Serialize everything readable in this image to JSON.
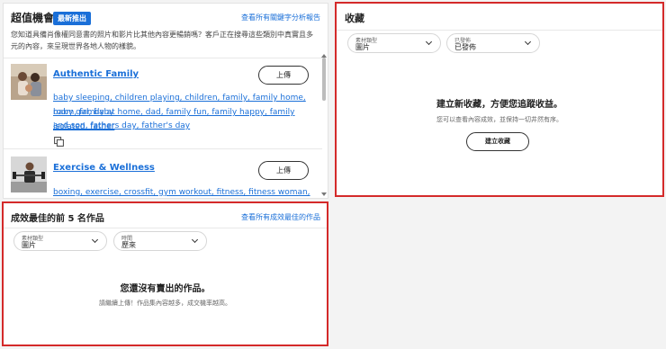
{
  "opportunities": {
    "title": "超值機會",
    "badge": "最新推出",
    "report_link": "查看所有關鍵字分析報告",
    "description": "您知道具備肖像權同意書的照片和影片比其他內容更暢銷嗎？客戶正在搜尋這些類別中真實且多元的內容，來呈現世界各地人物的樣貌。",
    "items": [
      {
        "title": "Authentic Family",
        "upload_label": "上傳",
        "keywords": [
          "baby sleeping, children playing, children, family, family home, baby girl, baby",
          "room, family at home, dad, family fun, family happy, family isolated, father",
          "and son, fathers day, father's day"
        ]
      },
      {
        "title": "Exercise & Wellness",
        "upload_label": "上傳",
        "keywords": [
          "boxing, exercise, crossfit, gym workout, fitness, fitness woman, bodybuilder,"
        ]
      }
    ]
  },
  "collections": {
    "title": "收藏",
    "filters": [
      {
        "label": "素材類型",
        "value": "圖片"
      },
      {
        "label": "已發佈",
        "value": "已發佈"
      }
    ],
    "empty_title": "建立新收藏，方便您追蹤收益。",
    "empty_subtitle": "您可以查看內容成效，並保持一切井然有序。",
    "create_button": "建立收藏"
  },
  "top_works": {
    "title": "成效最佳的前 5 名作品",
    "link": "查看所有成效最佳的作品",
    "filters": [
      {
        "label": "素材類型",
        "value": "圖片"
      },
      {
        "label": "時間",
        "value": "歷來"
      }
    ],
    "empty_title": "您還沒有賣出的作品。",
    "empty_subtitle": "請繼續上傳！作品集內容越多，成交機率越高。"
  },
  "colors": {
    "accent": "#1a6fd8",
    "highlight": "#d42a2a"
  }
}
